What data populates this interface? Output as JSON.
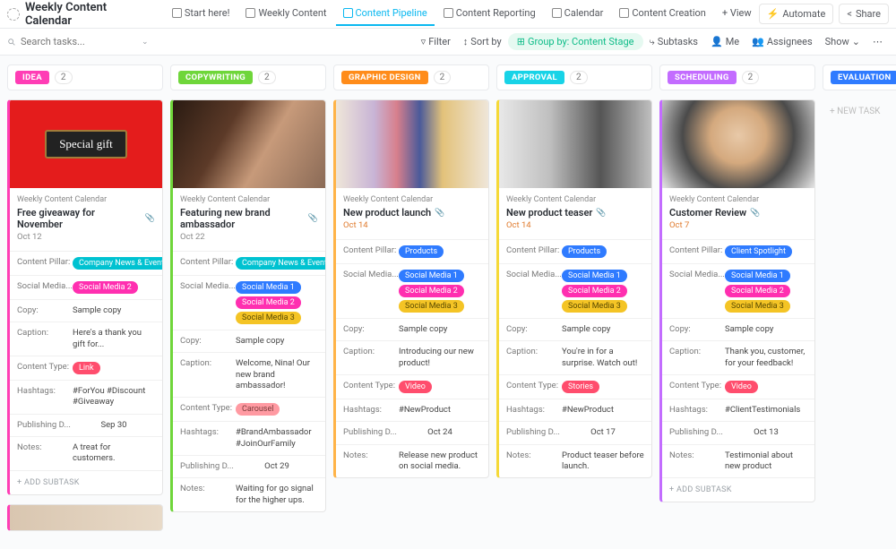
{
  "app": {
    "title": "Weekly Content Calendar"
  },
  "views": [
    {
      "label": "Start here!",
      "active": false
    },
    {
      "label": "Weekly Content",
      "active": false
    },
    {
      "label": "Content Pipeline",
      "active": true
    },
    {
      "label": "Content Reporting",
      "active": false
    },
    {
      "label": "Calendar",
      "active": false
    },
    {
      "label": "Content Creation",
      "active": false
    }
  ],
  "addView": "+ View",
  "headerButtons": {
    "automate": "Automate",
    "share": "Share"
  },
  "search": {
    "placeholder": "Search tasks..."
  },
  "toolbar": {
    "filter": "Filter",
    "sort": "Sort by",
    "group": "Group by: Content Stage",
    "subtasks": "Subtasks",
    "me": "Me",
    "assignees": "Assignees",
    "show": "Show"
  },
  "stages": [
    {
      "name": "IDEA",
      "count": 2,
      "bg": "#ff3db5",
      "accent": "#ff3db5"
    },
    {
      "name": "COPYWRITING",
      "count": 2,
      "bg": "#6fd63a",
      "accent": "#6fd63a"
    },
    {
      "name": "GRAPHIC DESIGN",
      "count": 2,
      "bg": "#ff8c1a",
      "accent": "#ffb347"
    },
    {
      "name": "APPROVAL",
      "count": 2,
      "bg": "#18d3e7",
      "accent": "#f5d938"
    },
    {
      "name": "SCHEDULING",
      "count": 2,
      "bg": "#c36cff",
      "accent": "#c36cff"
    },
    {
      "name": "EVALUATION",
      "count": 0,
      "bg": "#2f7bff",
      "accent": "#2f7bff"
    }
  ],
  "pills": {
    "companyNews": {
      "t": "Company News & Events",
      "c": "#00c2d1"
    },
    "products": {
      "t": "Products",
      "c": "#2f7bff"
    },
    "clientSpotlight": {
      "t": "Client Spotlight",
      "c": "#2f7bff"
    },
    "sm1": {
      "t": "Social Media 1",
      "c": "#2f7bff"
    },
    "sm2": {
      "t": "Social Media 2",
      "c": "#ff2fb0"
    },
    "sm3": {
      "t": "Social Media 3",
      "c": "#f4c425"
    },
    "link": {
      "t": "Link",
      "c": "#ff4d6d"
    },
    "carousel": {
      "t": "Carousel",
      "c": "#ff9aa2"
    },
    "video": {
      "t": "Video",
      "c": "#ff4d6d"
    },
    "stories": {
      "t": "Stories",
      "c": "#ff4d6d"
    }
  },
  "labels": {
    "crumb": "Weekly Content Calendar",
    "pillar": "Content Pillar:",
    "social": "Social Media...",
    "copy": "Copy:",
    "caption": "Caption:",
    "ctype": "Content Type:",
    "hashtags": "Hashtags:",
    "pubdate": "Publishing D...",
    "notes": "Notes:",
    "addSub": "+ ADD SUBTASK",
    "newTask": "+ NEW TASK",
    "sampleCopy": "Sample copy"
  },
  "cards": {
    "c1": {
      "title": "Free giveaway for November",
      "date": "Oct 12",
      "caption": "Here's a thank you gift for...",
      "hashtags": "#ForYou #Discount #Giveaway",
      "pub": "Sep 30",
      "notes": "A treat for customers."
    },
    "c2": {
      "title": "Featuring new brand ambassador",
      "date": "Oct 22",
      "caption": "Welcome, Nina! Our new brand ambassador!",
      "hashtags": "#BrandAmbassador #JoinOurFamily",
      "pub": "Oct 29",
      "notes": "Waiting for go signal for the higher ups."
    },
    "c3": {
      "title": "New product launch",
      "date": "Oct 14",
      "caption": "Introducing our new product!",
      "hashtags": "#NewProduct",
      "pub": "Oct 24",
      "notes": "Release new product on social media."
    },
    "c4": {
      "title": "New product teaser",
      "date": "Oct 14",
      "caption": "You're in for a surprise. Watch out!",
      "hashtags": "#NewProduct",
      "pub": "Oct 17",
      "notes": "Product teaser before launch."
    },
    "c5": {
      "title": "Customer Review",
      "date": "Oct 7",
      "caption": "Thank you, customer, for your feedback!",
      "hashtags": "#ClientTestimonials",
      "pub": "Oct 13",
      "notes": "Testimonial about new product"
    }
  }
}
